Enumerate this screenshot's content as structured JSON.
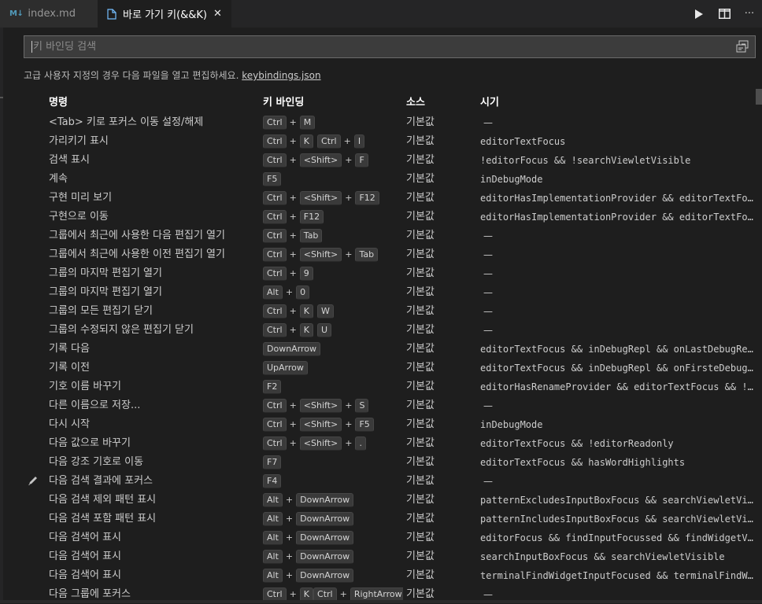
{
  "tabs": [
    {
      "icon": "M↓",
      "label": "index.md",
      "active": false
    },
    {
      "icon": "document-icon",
      "label": "바로 가기 키(&&K)",
      "close": "✕",
      "active": true
    }
  ],
  "actions": [
    {
      "name": "run-icon"
    },
    {
      "name": "split-editor-icon"
    },
    {
      "name": "more-icon",
      "glyph": "···"
    }
  ],
  "search": {
    "placeholder": "키 바인딩 검색",
    "value": ""
  },
  "hint": {
    "text": "고급 사용자 지정의 경우 다음 파일을 열고 편집하세요. ",
    "link": "keybindings.json"
  },
  "table": {
    "headers": {
      "command": "명령",
      "keybinding": "키 바인딩",
      "source": "소스",
      "when": "시기"
    },
    "rows": [
      {
        "command": "<Tab> 키로 포커스 이동 설정/해제",
        "keys": [
          [
            "Ctrl",
            "M"
          ]
        ],
        "source": "기본값",
        "when": "—"
      },
      {
        "command": "가리키기 표시",
        "keys": [
          [
            "Ctrl",
            "K"
          ],
          [
            "Ctrl",
            "I"
          ]
        ],
        "source": "기본값",
        "when": "editorTextFocus"
      },
      {
        "command": "검색 표시",
        "keys": [
          [
            "Ctrl",
            "<Shift>",
            "F"
          ]
        ],
        "source": "기본값",
        "when": "!editorFocus && !searchViewletVisible"
      },
      {
        "command": "계속",
        "keys": [
          [
            "F5"
          ]
        ],
        "source": "기본값",
        "when": "inDebugMode"
      },
      {
        "command": "구현 미리 보기",
        "keys": [
          [
            "Ctrl",
            "<Shift>",
            "F12"
          ]
        ],
        "source": "기본값",
        "when": "editorHasImplementationProvider && editorTextFocus && !isInEmbeddedEditor"
      },
      {
        "command": "구현으로 이동",
        "keys": [
          [
            "Ctrl",
            "F12"
          ]
        ],
        "source": "기본값",
        "when": "editorHasImplementationProvider && editorTextFocus && !isInEmbeddedEditor"
      },
      {
        "command": "그룹에서 최근에 사용한 다음 편집기 열기",
        "keys": [
          [
            "Ctrl",
            "Tab"
          ]
        ],
        "source": "기본값",
        "when": "—"
      },
      {
        "command": "그룹에서 최근에 사용한 이전 편집기 열기",
        "keys": [
          [
            "Ctrl",
            "<Shift>",
            "Tab"
          ]
        ],
        "source": "기본값",
        "when": "—"
      },
      {
        "command": "그룹의 마지막 편집기 열기",
        "keys": [
          [
            "Ctrl",
            "9"
          ]
        ],
        "source": "기본값",
        "when": "—"
      },
      {
        "command": "그룹의 마지막 편집기 열기",
        "keys": [
          [
            "Alt",
            "0"
          ]
        ],
        "source": "기본값",
        "when": "—"
      },
      {
        "command": "그룹의 모든 편집기 닫기",
        "keys": [
          [
            "Ctrl",
            "K"
          ],
          [
            "W"
          ]
        ],
        "source": "기본값",
        "when": "—"
      },
      {
        "command": "그룹의 수정되지 않은 편집기 닫기",
        "keys": [
          [
            "Ctrl",
            "K"
          ],
          [
            "U"
          ]
        ],
        "source": "기본값",
        "when": "—"
      },
      {
        "command": "기록 다음",
        "keys": [
          [
            "DownArrow"
          ]
        ],
        "source": "기본값",
        "when": "editorTextFocus && inDebugRepl && onLastDebugReplLine"
      },
      {
        "command": "기록 이전",
        "keys": [
          [
            "UpArrow"
          ]
        ],
        "source": "기본값",
        "when": "editorTextFocus && inDebugRepl && onFirsteDebugReplLine"
      },
      {
        "command": "기호 이름 바꾸기",
        "keys": [
          [
            "F2"
          ]
        ],
        "source": "기본값",
        "when": "editorHasRenameProvider && editorTextFocus && !editorReadonly"
      },
      {
        "command": "다른 이름으로 저장...",
        "keys": [
          [
            "Ctrl",
            "<Shift>",
            "S"
          ]
        ],
        "source": "기본값",
        "when": "—"
      },
      {
        "command": "다시 시작",
        "keys": [
          [
            "Ctrl",
            "<Shift>",
            "F5"
          ]
        ],
        "source": "기본값",
        "when": "inDebugMode"
      },
      {
        "command": "다음 값으로 바꾸기",
        "keys": [
          [
            "Ctrl",
            "<Shift>",
            "."
          ]
        ],
        "source": "기본값",
        "when": "editorTextFocus && !editorReadonly"
      },
      {
        "command": "다음 강조 기호로 이동",
        "keys": [
          [
            "F7"
          ]
        ],
        "source": "기본값",
        "when": "editorTextFocus && hasWordHighlights"
      },
      {
        "command": "다음 검색 결과에 포커스",
        "keys": [
          [
            "F4"
          ]
        ],
        "source": "기본값",
        "when": "—",
        "editing": true
      },
      {
        "command": "다음 검색 제외 패턴 표시",
        "keys": [
          [
            "Alt",
            "DownArrow"
          ]
        ],
        "source": "기본값",
        "when": "patternExcludesInputBoxFocus && searchViewletVisible"
      },
      {
        "command": "다음 검색 포함 패턴 표시",
        "keys": [
          [
            "Alt",
            "DownArrow"
          ]
        ],
        "source": "기본값",
        "when": "patternIncludesInputBoxFocus && searchViewletVisible"
      },
      {
        "command": "다음 검색어 표시",
        "keys": [
          [
            "Alt",
            "DownArrow"
          ]
        ],
        "source": "기본값",
        "when": "editorFocus && findInputFocussed && findWidgetVisible"
      },
      {
        "command": "다음 검색어 표시",
        "keys": [
          [
            "Alt",
            "DownArrow"
          ]
        ],
        "source": "기본값",
        "when": "searchInputBoxFocus && searchViewletVisible"
      },
      {
        "command": "다음 검색어 표시",
        "keys": [
          [
            "Alt",
            "DownArrow"
          ]
        ],
        "source": "기본값",
        "when": "terminalFindWidgetInputFocused && terminalFindWidgetVisible"
      },
      {
        "command": "다음 그룹에 포커스",
        "keys": [
          [
            "Ctrl",
            "K"
          ],
          [
            "Ctrl",
            "RightArrow"
          ]
        ],
        "source": "기본값",
        "when": "—"
      }
    ]
  }
}
